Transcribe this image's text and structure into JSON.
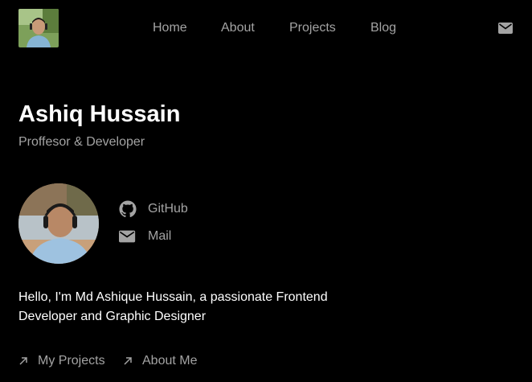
{
  "header": {
    "logo": "profile-photo-logo",
    "nav": {
      "home": "Home",
      "about": "About",
      "projects": "Projects",
      "blog": "Blog"
    },
    "mail_icon": "mail-icon"
  },
  "hero": {
    "name": "Ashiq Hussain",
    "role": "Proffesor & Developer"
  },
  "profile": {
    "avatar": "profile-photo",
    "social": {
      "github": "GitHub",
      "mail": "Mail"
    }
  },
  "bio": "Hello, I'm Md Ashique Hussain, a passionate Frontend Developer and Graphic Designer",
  "links": {
    "projects": "My Projects",
    "about": "About Me"
  },
  "colors": {
    "background": "#000000",
    "text": "#ffffff",
    "muted": "#a3a3a3"
  }
}
